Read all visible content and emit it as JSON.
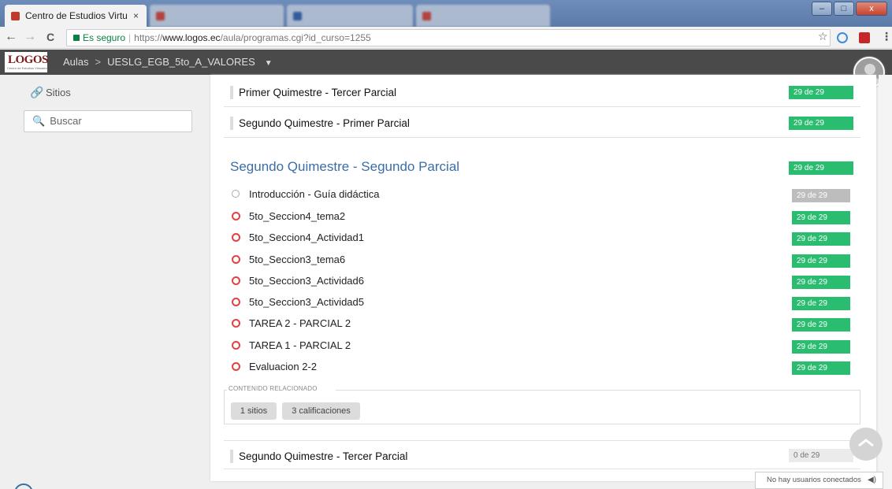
{
  "browser": {
    "tabs": [
      {
        "title": "Centro de Estudios Virtu",
        "active": true
      },
      {
        "title": "",
        "active": false
      },
      {
        "title": "",
        "active": false
      },
      {
        "title": "",
        "active": false
      }
    ],
    "tab_close": "×",
    "window_buttons": {
      "minimize": "–",
      "maximize": "□",
      "close": "x"
    },
    "nav": {
      "back": "←",
      "forward": "→",
      "reload": "C"
    },
    "secure_label": "Es seguro",
    "url_scheme": "https://",
    "url_host": "www.logos.ec",
    "url_path": "/aula/programas.cgi?id_curso=1255",
    "star": "☆"
  },
  "app": {
    "logo": "LOGOS",
    "logo_sub": "Centro de Estudios Virtuales",
    "breadcrumb": {
      "root": "Aulas",
      "separator": ">",
      "current": "UESLG_EGB_5to_A_VALORES",
      "caret": "▼"
    }
  },
  "sidebar": {
    "sites_label": "Sitios",
    "search_placeholder": "Buscar"
  },
  "sections": [
    {
      "title": "Primer Quimestre - Tercer Parcial",
      "progress": "29 de 29",
      "complete": true
    },
    {
      "title": "Segundo Quimestre - Primer Parcial",
      "progress": "29 de 29",
      "complete": true
    },
    {
      "title": "Segundo Quimestre - Segundo Parcial",
      "progress": "29 de 29",
      "complete": true
    },
    {
      "title": "Segundo Quimestre - Tercer Parcial",
      "progress": "0 de 29",
      "complete": false
    }
  ],
  "active_items": [
    {
      "label": "Introducción - Guía didáctica",
      "progress": "29 de 29",
      "status": "gray"
    },
    {
      "label": "5to_Seccion4_tema2",
      "progress": "29 de 29",
      "status": "red"
    },
    {
      "label": "5to_Seccion4_Actividad1",
      "progress": "29 de 29",
      "status": "red"
    },
    {
      "label": "5to_Seccion3_tema6",
      "progress": "29 de 29",
      "status": "red"
    },
    {
      "label": "5to_Seccion3_Actividad6",
      "progress": "29 de 29",
      "status": "red"
    },
    {
      "label": "5to_Seccion3_Actividad5",
      "progress": "29 de 29",
      "status": "red"
    },
    {
      "label": "TAREA 2 - PARCIAL 2",
      "progress": "29 de 29",
      "status": "red"
    },
    {
      "label": "TAREA 1 - PARCIAL 2",
      "progress": "29 de 29",
      "status": "red"
    },
    {
      "label": "Evaluacion 2-2",
      "progress": "29 de 29",
      "status": "red"
    }
  ],
  "related": {
    "legend": "CONTENIDO RELACIONADO",
    "chips": [
      "1 sitios",
      "3 calificaciones"
    ]
  },
  "status_bar": {
    "text": "No hay usuarios conectados",
    "speaker": "◀)"
  },
  "colors": {
    "complete": "#2bbd6f",
    "pending": "#bdbdbd",
    "link": "#3a6ea5",
    "ring": "#e2423f"
  }
}
